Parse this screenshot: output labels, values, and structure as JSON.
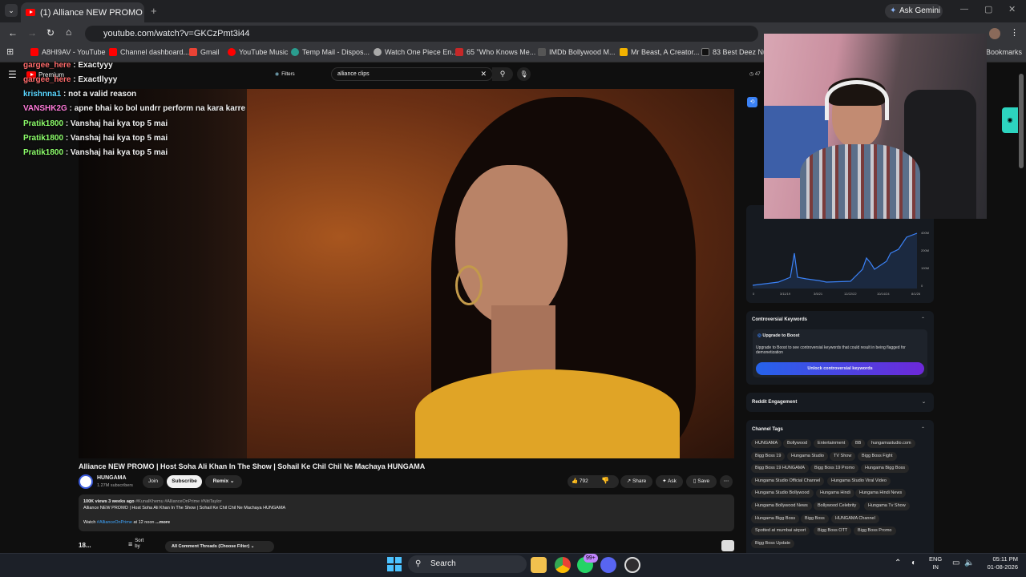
{
  "browser": {
    "tab_title": "(1) Alliance NEW PROMO | Host",
    "ask_gemini": "Ask Gemini",
    "url": "youtube.com/watch?v=GKCzPmt3i44",
    "bookmarks": [
      "A8HI9AV - YouTube",
      "Channel dashboard...",
      "Gmail",
      "YouTube Music",
      "Temp Mail - Dispos...",
      "Watch One Piece En...",
      "65 \"Who Knows Me...",
      "IMDb Bollywood M...",
      "Mr Beast, A Creator...",
      "83 Best Deez Nuts",
      "Bookmarks"
    ]
  },
  "youtube": {
    "logo": "Premium",
    "filters": "Filters",
    "search_value": "alliance clips",
    "side_count": "47",
    "video_title": "Alliance NEW PROMO | Host Soha Ali Khan In The Show | Sohail Ke Chil Chil Ne Machaya HUNGAMA",
    "channel": {
      "name": "HUNGAMA",
      "subs": "1.27M subscribers",
      "join": "Join",
      "subscribe": "Subscribe",
      "remix": "Remix"
    },
    "actions": {
      "likes": "792",
      "share": "Share",
      "ask": "Ask",
      "save": "Save"
    },
    "description": {
      "stats": "100K views  3 weeks ago",
      "tags": "#KunalKhemu #AllianceOnPrime #NitiTaylor",
      "line1": "Alliance NEW PROMO | Host Soha Ali Khan In The Show | Sohail Ke Chil Chil Ne Machaya HUNGAMA",
      "watch": "Watch",
      "link": "#AllianceOnPrime",
      "rest": "at 12 noon",
      "more": "...more"
    },
    "comments": {
      "count": "18...",
      "sort": "Sort by",
      "filter": "All Comment Threads (Choose Filter)"
    }
  },
  "chat": [
    {
      "user": "gargee_here",
      "msg": ": Exactyyy",
      "color": "#ff6b6b"
    },
    {
      "user": "gargee_here",
      "msg": ": Exactllyyy",
      "color": "#ff6b6b"
    },
    {
      "user": "krishnna1",
      "msg": ": not a valid reason",
      "color": "#5ad6ff"
    },
    {
      "user": "VANSHK2G",
      "msg": ": apne bhai ko bol undrr perform na kara karre",
      "color": "#ff7ad9"
    },
    {
      "user": "Pratik1800",
      "msg": ": Vanshaj hai kya top 5 mai",
      "color": "#8dff6b"
    },
    {
      "user": "Pratik1800",
      "msg": ": Vanshaj hai kya top 5 mai",
      "color": "#8dff6b"
    },
    {
      "user": "Pratik1800",
      "msg": ": Vanshaj hai kya top 5 mai",
      "color": "#8dff6b"
    }
  ],
  "panel": {
    "chart_ticks_y": [
      "400M",
      "200M",
      "100M",
      "0"
    ],
    "chart_ticks_x": [
      "0",
      "3/11/19",
      "3/5/21",
      "12/22/22",
      "10/14/24",
      "8/1/26"
    ],
    "controversial": {
      "title": "Controversial Keywords",
      "upgrade": "Upgrade to Boost",
      "desc": "Upgrade to Boost to see controversial keywords that could result in being flagged for demonetization",
      "button": "Unlock controversial keywords"
    },
    "reddit": "Reddit Engagement",
    "tags_title": "Channel Tags",
    "tags": [
      [
        "HUNGAMA",
        "Bollywood",
        "Entertainment",
        "BB",
        "hungamastudio.com"
      ],
      [
        "Bigg Boss 19",
        "Hungama Studio",
        "TV Show",
        "Bigg Boss Fight"
      ],
      [
        "Bigg Boss 19 HUNGAMA",
        "Bigg Boss 19 Promo",
        "Hungama Bigg Boss"
      ],
      [
        "Hungama Studio Official Channel",
        "Hungama Studio Viral Video"
      ],
      [
        "Hungama Studio Bollywood",
        "Hungama Hindi",
        "Hungama Hindi News"
      ],
      [
        "Hungama Bollywood News",
        "Bollywood Celebrity",
        "Hungama Tv Show"
      ],
      [
        "Hungama Bigg Boss",
        "Bigg Boss",
        "HUNGAMA Channel"
      ],
      [
        "Spotted at mumbai airport",
        "Bigg Boss OTT",
        "Bigg Boss Promo"
      ],
      [
        "Bigg Boss Update"
      ]
    ]
  },
  "taskbar": {
    "search": "Search",
    "badge": "99+",
    "lang1": "ENG",
    "lang2": "IN",
    "time": "05:11 PM",
    "date": "01-08-2026"
  }
}
